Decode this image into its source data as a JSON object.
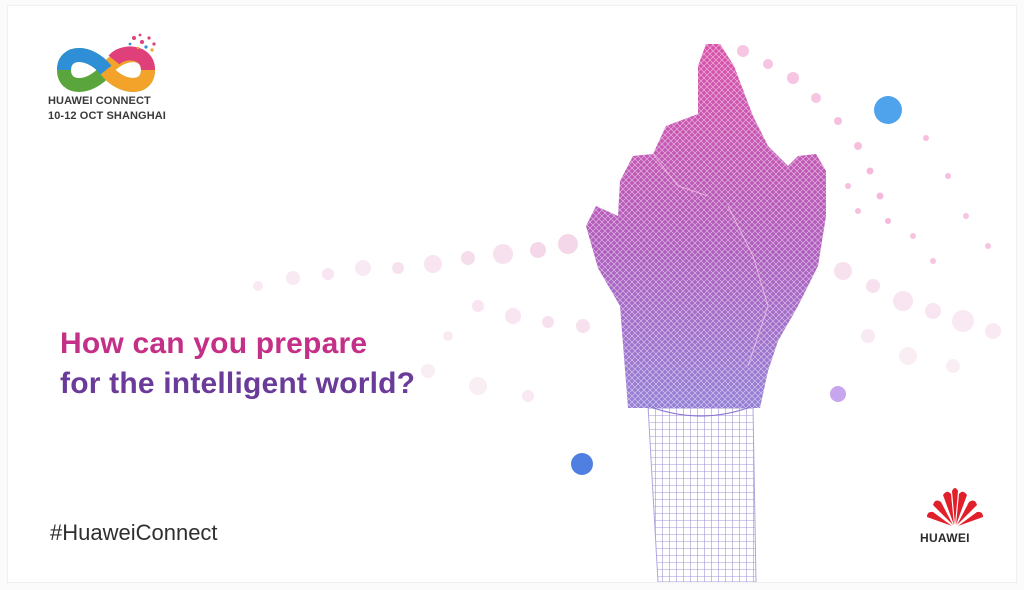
{
  "event": {
    "name": "HUAWEI CONNECT",
    "dates_location": "10-12 OCT  SHANGHAI"
  },
  "headline": {
    "line1": "How can you prepare",
    "line2": "for the intelligent world?"
  },
  "hashtag": "#HuaweiConnect",
  "brand": {
    "name": "HUAWEI",
    "logo_icon": "huawei-petal-logo"
  },
  "colors": {
    "headline_pink": "#c42f87",
    "headline_purple": "#6a3b98",
    "huawei_red": "#e0202a",
    "dot_blue": "#4fa3ec"
  }
}
